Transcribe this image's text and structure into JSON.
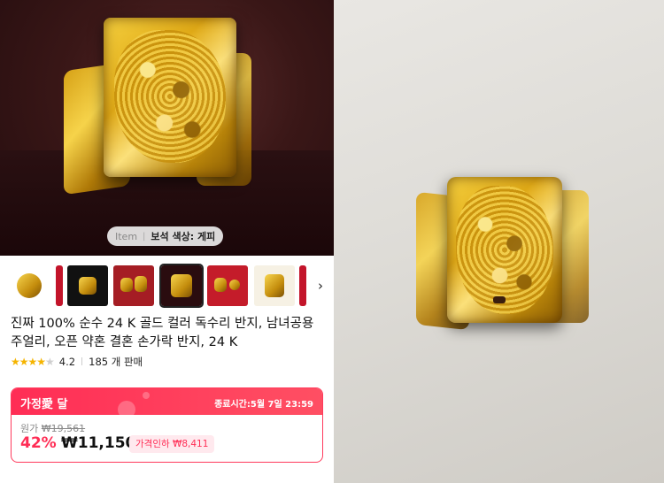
{
  "hero": {
    "chip_item": "Item",
    "chip_label": "보석 색상: 게피"
  },
  "thumbnails": {
    "count": 7,
    "selected_index": 4,
    "next_icon": "chevron-right-icon"
  },
  "product": {
    "title": "진짜 100% 순수 24 K 골드 컬러 독수리 반지, 남녀공용 주얼리, 오픈 약혼 결혼 손가락 반지, 24 K",
    "rating_stars": "★★★★★",
    "rating": "4.2",
    "rating_value": 4.2,
    "sold": "185 개 판매"
  },
  "deal": {
    "label": "가정愛 달",
    "end_time": "종료시간:5월 7일 23:59",
    "original_label": "원가",
    "original_price": "₩19,561",
    "discount": "42%",
    "price": "₩11,150",
    "price_cut": "가격인하 ₩8,411",
    "accent_color": "#ff2d55"
  }
}
